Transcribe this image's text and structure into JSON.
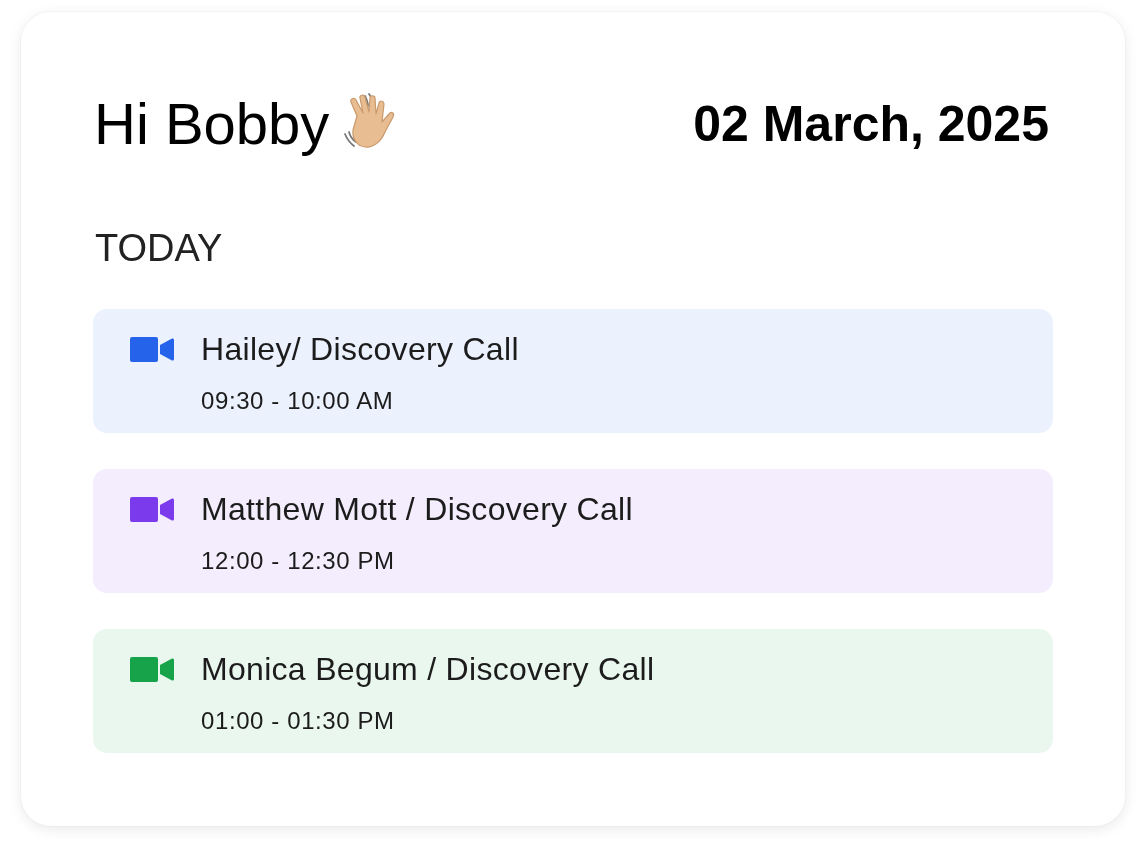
{
  "greeting": "Hi Bobby",
  "date": "02 March, 2025",
  "section_title": "TODAY",
  "events": [
    {
      "title": "Hailey/ Discovery Call",
      "time": "09:30 - 10:00 AM",
      "color": "#2563eb"
    },
    {
      "title": "Matthew Mott / Discovery Call",
      "time": "12:00 - 12:30 PM",
      "color": "#7c3aed"
    },
    {
      "title": "Monica Begum / Discovery Call",
      "time": "01:00 - 01:30 PM",
      "color": "#16a34a"
    }
  ]
}
